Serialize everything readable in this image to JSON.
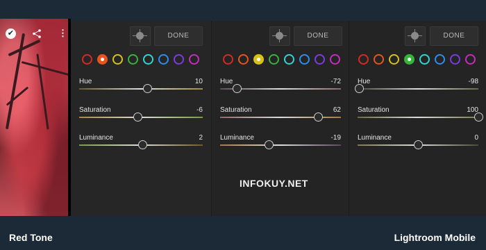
{
  "footer": {
    "left_caption": "Red Tone",
    "right_caption": "Lightroom Mobile"
  },
  "watermark": "INFOKUY.NET",
  "phone": {
    "icons": [
      "check-circle-icon",
      "share-icon",
      "more-vertical-icon"
    ]
  },
  "color_swatches": [
    "#d62b1f",
    "#e8541c",
    "#d8c21a",
    "#35b53a",
    "#2fd6d6",
    "#2b8ff0",
    "#7a3ce0",
    "#c62bc2"
  ],
  "panels": [
    {
      "done_label": "DONE",
      "selected_color_index": 1,
      "sliders": [
        {
          "label": "Hue",
          "value": "10",
          "fraction": 0.55
        },
        {
          "label": "Saturation",
          "value": "-6",
          "fraction": 0.47
        },
        {
          "label": "Luminance",
          "value": "2",
          "fraction": 0.51
        }
      ]
    },
    {
      "done_label": "DONE",
      "selected_color_index": 2,
      "sliders": [
        {
          "label": "Hue",
          "value": "-72",
          "fraction": 0.14
        },
        {
          "label": "Saturation",
          "value": "62",
          "fraction": 0.81
        },
        {
          "label": "Luminance",
          "value": "-19",
          "fraction": 0.4
        }
      ]
    },
    {
      "done_label": "DONE",
      "selected_color_index": 3,
      "sliders": [
        {
          "label": "Hue",
          "value": "-98",
          "fraction": 0.01
        },
        {
          "label": "Saturation",
          "value": "100",
          "fraction": 1.0
        },
        {
          "label": "Luminance",
          "value": "0",
          "fraction": 0.5
        }
      ]
    }
  ]
}
